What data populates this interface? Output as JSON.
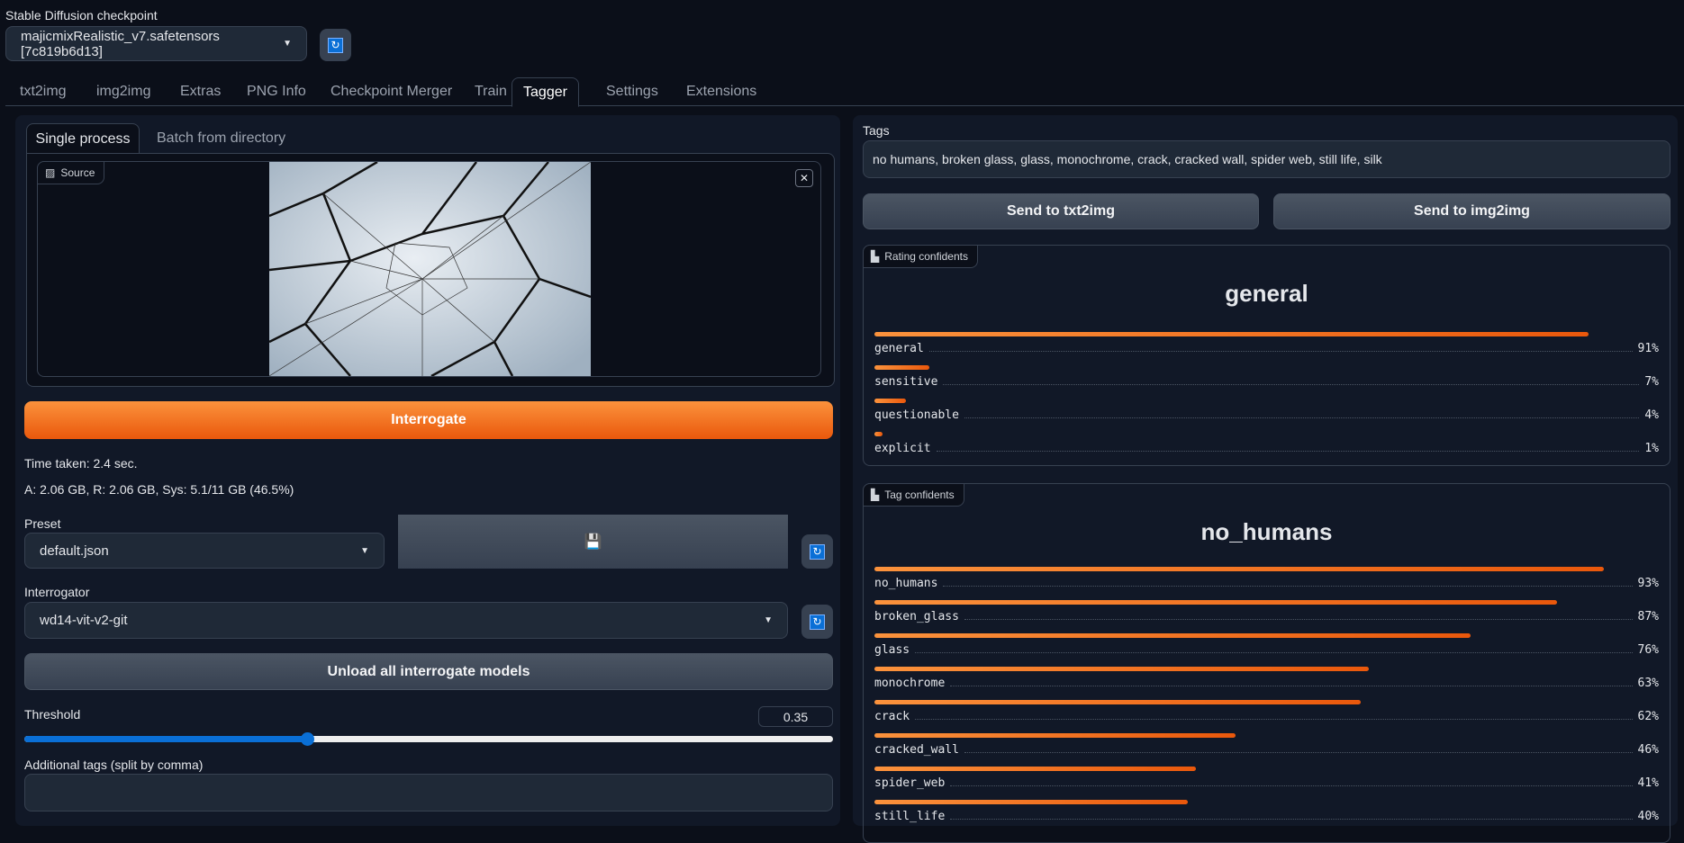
{
  "checkpoint": {
    "label": "Stable Diffusion checkpoint",
    "value": "majicmixRealistic_v7.safetensors [7c819b6d13]"
  },
  "tabs": [
    "txt2img",
    "img2img",
    "Extras",
    "PNG Info",
    "Checkpoint Merger",
    "Train",
    "Tagger",
    "Settings",
    "Extensions"
  ],
  "active_tab": "Tagger",
  "left": {
    "subtabs": [
      "Single process",
      "Batch from directory"
    ],
    "source_label": "Source",
    "interrogate": "Interrogate",
    "time_taken": "Time taken: 2.4 sec.",
    "memory": "A: 2.06 GB, R: 2.06 GB, Sys: 5.1/11 GB (46.5%)",
    "preset_label": "Preset",
    "preset_value": "default.json",
    "interrogator_label": "Interrogator",
    "interrogator_value": "wd14-vit-v2-git",
    "unload": "Unload all interrogate models",
    "threshold_label": "Threshold",
    "threshold_value": "0.35",
    "threshold": 0.35,
    "additional_label": "Additional tags (split by comma)",
    "additional_value": ""
  },
  "right": {
    "tags_label": "Tags",
    "tags_value": "no humans, broken glass, glass, monochrome, crack, cracked wall, spider web, still life, silk",
    "send_txt2img": "Send to txt2img",
    "send_img2img": "Send to img2img",
    "rating": {
      "label": "Rating confidents",
      "top": "general",
      "items": [
        {
          "name": "general",
          "pct": "91%",
          "v": 91
        },
        {
          "name": "sensitive",
          "pct": "7%",
          "v": 7
        },
        {
          "name": "questionable",
          "pct": "4%",
          "v": 4
        },
        {
          "name": "explicit",
          "pct": "1%",
          "v": 1
        }
      ]
    },
    "tag": {
      "label": "Tag confidents",
      "top": "no_humans",
      "items": [
        {
          "name": "no_humans",
          "pct": "93%",
          "v": 93
        },
        {
          "name": "broken_glass",
          "pct": "87%",
          "v": 87
        },
        {
          "name": "glass",
          "pct": "76%",
          "v": 76
        },
        {
          "name": "monochrome",
          "pct": "63%",
          "v": 63
        },
        {
          "name": "crack",
          "pct": "62%",
          "v": 62
        },
        {
          "name": "cracked_wall",
          "pct": "46%",
          "v": 46
        },
        {
          "name": "spider_web",
          "pct": "41%",
          "v": 41
        },
        {
          "name": "still_life",
          "pct": "40%",
          "v": 40
        }
      ]
    }
  },
  "colors": {
    "accent": "#f97316",
    "slider": "#0a6fd6"
  }
}
